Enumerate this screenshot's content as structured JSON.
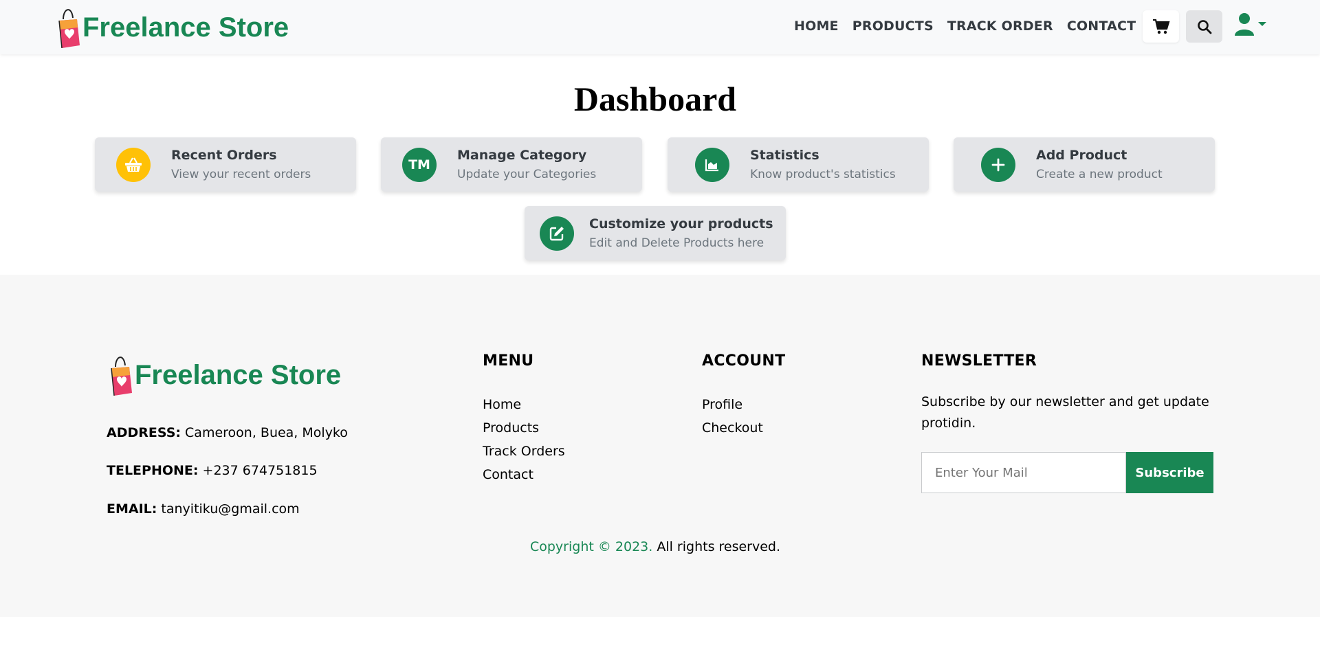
{
  "header": {
    "brand": "Freelance Store",
    "nav": [
      "HOME",
      "PRODUCTS",
      "TRACK ORDER",
      "CONTACT"
    ],
    "icons": [
      "cart-icon",
      "search-icon",
      "user-icon",
      "caret-down-icon"
    ]
  },
  "dashboard": {
    "title": "Dashboard",
    "cards": [
      {
        "title": "Recent Orders",
        "subtitle": "View your recent orders",
        "icon": "basket-icon",
        "color": "#ffc107"
      },
      {
        "title": "Manage Category",
        "subtitle": "Update your Categories",
        "icon": "trademark-icon",
        "icon_text": "TM",
        "color": "#198754"
      },
      {
        "title": "Statistics",
        "subtitle": "Know product's statistics",
        "icon": "chart-area-icon",
        "color": "#198754"
      },
      {
        "title": "Add Product",
        "subtitle": "Create a new product",
        "icon": "plus-icon",
        "color": "#198754"
      },
      {
        "title": "Customize your products",
        "subtitle": "Edit and Delete Products here",
        "icon": "edit-icon",
        "color": "#198754"
      }
    ]
  },
  "footer": {
    "brand": "Freelance Store",
    "address_label": "ADDRESS:",
    "address": "Cameroon, Buea, Molyko",
    "telephone_label": "TELEPHONE:",
    "telephone": "+237 674751815",
    "email_label": "EMAIL:",
    "email": "tanyitiku@gmail.com",
    "menu_heading": "MENU",
    "menu": [
      "Home",
      "Products",
      "Track Orders",
      "Contact"
    ],
    "account_heading": "ACCOUNT",
    "account": [
      "Profile",
      "Checkout"
    ],
    "newsletter_heading": "NEWSLETTER",
    "newsletter_text": "Subscribe by our newsletter and get update protidin.",
    "newsletter_placeholder": "Enter Your Mail",
    "subscribe_label": "Subscribe",
    "copyright_green": "Copyright © 2023.",
    "copyright_rest": "All rights reserved."
  },
  "colors": {
    "brand": "#198754",
    "accent": "#ffc107",
    "logo_pink": "#e83e6c"
  }
}
